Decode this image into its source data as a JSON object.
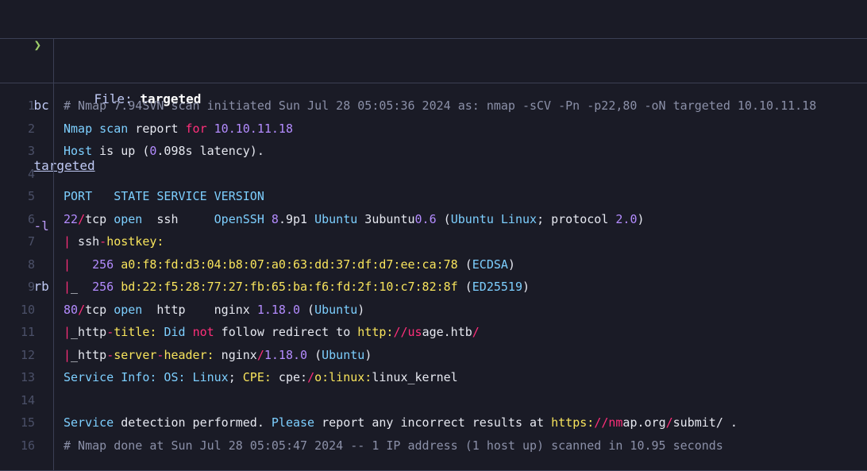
{
  "prompt": {
    "symbol": "❯",
    "command": "bc",
    "argument": "targeted",
    "flag": "-l",
    "option_value": "rb"
  },
  "file_header": {
    "label": "File: ",
    "filename": "targeted"
  },
  "colors": {
    "background": "#1a1b26",
    "comment": "#8b90a8",
    "blue": "#7dcfff",
    "pink": "#ff2f7a",
    "purple": "#b48cff",
    "yellow": "#f8e45c",
    "green": "#9ece6a"
  },
  "lines": [
    {
      "n": "1",
      "tokens": [
        {
          "t": "# Nmap 7.94SVN scan initiated Sun Jul 28 05:05:36 2024 as: nmap -sCV -Pn -p22,80 -oN targeted 10.10.11.18",
          "c": "comment"
        }
      ]
    },
    {
      "n": "2",
      "tokens": [
        {
          "t": "Nmap scan",
          "c": "blue"
        },
        {
          "t": " report ",
          "c": "plain"
        },
        {
          "t": "for",
          "c": "pink"
        },
        {
          "t": " ",
          "c": "plain"
        },
        {
          "t": "10.10.11.18",
          "c": "purple"
        }
      ]
    },
    {
      "n": "3",
      "tokens": [
        {
          "t": "Host",
          "c": "blue"
        },
        {
          "t": " is up (",
          "c": "plain"
        },
        {
          "t": "0",
          "c": "purple"
        },
        {
          "t": ".098s latency).",
          "c": "plain"
        }
      ]
    },
    {
      "n": "4",
      "tokens": []
    },
    {
      "n": "5",
      "tokens": [
        {
          "t": "PORT   STATE SERVICE VERSION",
          "c": "blue"
        }
      ]
    },
    {
      "n": "6",
      "tokens": [
        {
          "t": "22",
          "c": "purple"
        },
        {
          "t": "/",
          "c": "pink"
        },
        {
          "t": "tcp ",
          "c": "plain"
        },
        {
          "t": "open",
          "c": "blue"
        },
        {
          "t": "  ssh     ",
          "c": "plain"
        },
        {
          "t": "OpenSSH",
          "c": "blue"
        },
        {
          "t": " ",
          "c": "plain"
        },
        {
          "t": "8",
          "c": "purple"
        },
        {
          "t": ".9p1 ",
          "c": "plain"
        },
        {
          "t": "Ubuntu",
          "c": "blue"
        },
        {
          "t": " 3ubuntu",
          "c": "plain"
        },
        {
          "t": "0.6",
          "c": "purple"
        },
        {
          "t": " (",
          "c": "plain"
        },
        {
          "t": "Ubuntu Linux",
          "c": "blue"
        },
        {
          "t": "; protocol ",
          "c": "plain"
        },
        {
          "t": "2.0",
          "c": "purple"
        },
        {
          "t": ")",
          "c": "plain"
        }
      ]
    },
    {
      "n": "7",
      "tokens": [
        {
          "t": "|",
          "c": "pink"
        },
        {
          "t": " ssh",
          "c": "plain"
        },
        {
          "t": "-",
          "c": "pink"
        },
        {
          "t": "hostkey:",
          "c": "yellow"
        }
      ]
    },
    {
      "n": "8",
      "tokens": [
        {
          "t": "|",
          "c": "pink"
        },
        {
          "t": "   ",
          "c": "plain"
        },
        {
          "t": "256",
          "c": "purple"
        },
        {
          "t": " ",
          "c": "plain"
        },
        {
          "t": "a0:f8:fd:d3:04:b8:07:a0:63:dd:37:df:d7:ee:ca:78",
          "c": "yellow"
        },
        {
          "t": " (",
          "c": "plain"
        },
        {
          "t": "ECDSA",
          "c": "blue"
        },
        {
          "t": ")",
          "c": "plain"
        }
      ]
    },
    {
      "n": "9",
      "tokens": [
        {
          "t": "|",
          "c": "pink"
        },
        {
          "t": "_  ",
          "c": "plain"
        },
        {
          "t": "256",
          "c": "purple"
        },
        {
          "t": " ",
          "c": "plain"
        },
        {
          "t": "bd:22:f5:28:77:27:fb:65:ba:f6:fd:2f:10:c7:82:8f",
          "c": "yellow"
        },
        {
          "t": " (",
          "c": "plain"
        },
        {
          "t": "ED25519",
          "c": "blue"
        },
        {
          "t": ")",
          "c": "plain"
        }
      ]
    },
    {
      "n": "10",
      "tokens": [
        {
          "t": "80",
          "c": "purple"
        },
        {
          "t": "/",
          "c": "pink"
        },
        {
          "t": "tcp ",
          "c": "plain"
        },
        {
          "t": "open",
          "c": "blue"
        },
        {
          "t": "  http    nginx ",
          "c": "plain"
        },
        {
          "t": "1.18.0",
          "c": "purple"
        },
        {
          "t": " (",
          "c": "plain"
        },
        {
          "t": "Ubuntu",
          "c": "blue"
        },
        {
          "t": ")",
          "c": "plain"
        }
      ]
    },
    {
      "n": "11",
      "tokens": [
        {
          "t": "|",
          "c": "pink"
        },
        {
          "t": "_http",
          "c": "plain"
        },
        {
          "t": "-",
          "c": "pink"
        },
        {
          "t": "title:",
          "c": "yellow"
        },
        {
          "t": " ",
          "c": "plain"
        },
        {
          "t": "Did",
          "c": "blue"
        },
        {
          "t": " ",
          "c": "plain"
        },
        {
          "t": "not",
          "c": "pink"
        },
        {
          "t": " follow redirect to ",
          "c": "plain"
        },
        {
          "t": "http:",
          "c": "yellow"
        },
        {
          "t": "//",
          "c": "pink"
        },
        {
          "t": "us",
          "c": "pink"
        },
        {
          "t": "age.htb",
          "c": "plain"
        },
        {
          "t": "/",
          "c": "pink"
        }
      ]
    },
    {
      "n": "12",
      "tokens": [
        {
          "t": "|",
          "c": "pink"
        },
        {
          "t": "_http",
          "c": "plain"
        },
        {
          "t": "-",
          "c": "pink"
        },
        {
          "t": "server",
          "c": "yellow"
        },
        {
          "t": "-",
          "c": "pink"
        },
        {
          "t": "header:",
          "c": "yellow"
        },
        {
          "t": " nginx",
          "c": "plain"
        },
        {
          "t": "/",
          "c": "pink"
        },
        {
          "t": "1.18.0",
          "c": "purple"
        },
        {
          "t": " (",
          "c": "plain"
        },
        {
          "t": "Ubuntu",
          "c": "blue"
        },
        {
          "t": ")",
          "c": "plain"
        }
      ]
    },
    {
      "n": "13",
      "tokens": [
        {
          "t": "Service Info: OS: Linux",
          "c": "blue"
        },
        {
          "t": "; ",
          "c": "plain"
        },
        {
          "t": "CPE:",
          "c": "yellow"
        },
        {
          "t": " cpe:",
          "c": "plain"
        },
        {
          "t": "/",
          "c": "pink"
        },
        {
          "t": "o:linux:",
          "c": "yellow"
        },
        {
          "t": "linux_kernel",
          "c": "plain"
        }
      ]
    },
    {
      "n": "14",
      "tokens": []
    },
    {
      "n": "15",
      "tokens": [
        {
          "t": "Service",
          "c": "blue"
        },
        {
          "t": " detection performed. ",
          "c": "plain"
        },
        {
          "t": "Please",
          "c": "blue"
        },
        {
          "t": " report any incorrect results at ",
          "c": "plain"
        },
        {
          "t": "https:",
          "c": "yellow"
        },
        {
          "t": "//",
          "c": "pink"
        },
        {
          "t": "nm",
          "c": "pink"
        },
        {
          "t": "ap.org",
          "c": "plain"
        },
        {
          "t": "/",
          "c": "pink"
        },
        {
          "t": "submit/ .",
          "c": "plain"
        }
      ]
    },
    {
      "n": "16",
      "tokens": [
        {
          "t": "# Nmap done at Sun Jul 28 05:05:47 2024 -- 1 IP address (1 host up) scanned in 10.95 seconds",
          "c": "comment"
        }
      ]
    }
  ]
}
